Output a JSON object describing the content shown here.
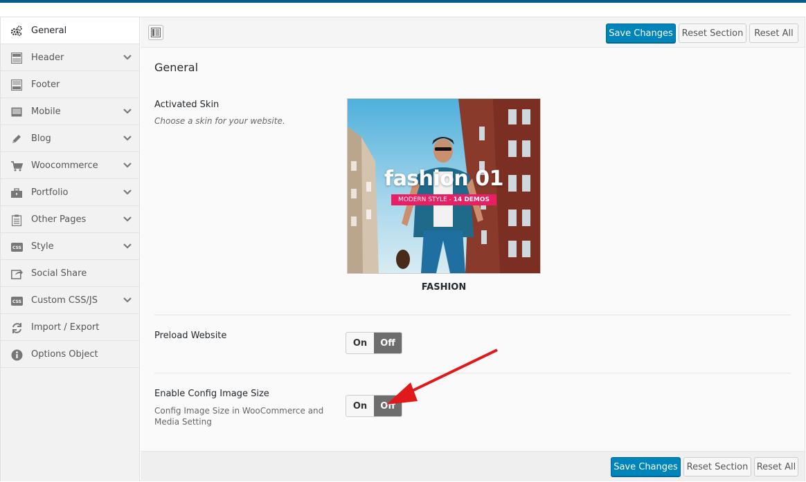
{
  "sidebar": {
    "items": [
      {
        "label": "General",
        "icon": "gears-icon",
        "expandable": false,
        "active": true
      },
      {
        "label": "Header",
        "icon": "header-icon",
        "expandable": true
      },
      {
        "label": "Footer",
        "icon": "footer-icon",
        "expandable": false
      },
      {
        "label": "Mobile",
        "icon": "mobile-icon",
        "expandable": true
      },
      {
        "label": "Blog",
        "icon": "pencil-icon",
        "expandable": true
      },
      {
        "label": "Woocommerce",
        "icon": "cart-icon",
        "expandable": true
      },
      {
        "label": "Portfolio",
        "icon": "briefcase-icon",
        "expandable": true
      },
      {
        "label": "Other Pages",
        "icon": "clipboard-icon",
        "expandable": true
      },
      {
        "label": "Style",
        "icon": "css-icon",
        "expandable": true
      },
      {
        "label": "Social Share",
        "icon": "share-icon",
        "expandable": false
      },
      {
        "label": "Custom CSS/JS",
        "icon": "css-icon",
        "expandable": true
      },
      {
        "label": "Import / Export",
        "icon": "refresh-icon",
        "expandable": false
      },
      {
        "label": "Options Object",
        "icon": "info-icon",
        "expandable": false
      }
    ]
  },
  "toolbar": {
    "save_label": "Save Changes",
    "reset_section_label": "Reset Section",
    "reset_all_label": "Reset All"
  },
  "section": {
    "title": "General",
    "fields": {
      "activated_skin": {
        "label": "Activated Skin",
        "description": "Choose a skin for your website.",
        "image_title": "fashion 01",
        "image_subtitle_a": "MODERN STYLE - ",
        "image_subtitle_b": "14 DEMOS",
        "caption": "FASHION"
      },
      "preload_website": {
        "label": "Preload Website",
        "on_label": "On",
        "off_label": "Off",
        "value": "Off"
      },
      "enable_config_image_size": {
        "label": "Enable Config Image Size",
        "description": "Config Image Size in WooCommerce and Media Setting",
        "on_label": "On",
        "off_label": "Off",
        "value": "Off"
      }
    }
  },
  "colors": {
    "primary": "#0085ba",
    "accent_pink": "#e91e63",
    "toggle_off": "#6d6d6d",
    "arrow": "#e0191b"
  }
}
